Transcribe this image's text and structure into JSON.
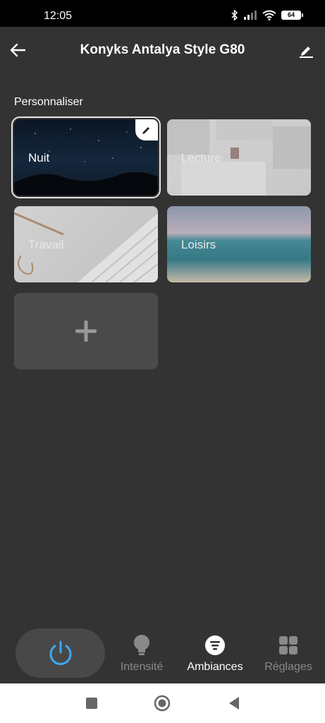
{
  "status_bar": {
    "time": "12:05",
    "battery": "64"
  },
  "app_bar": {
    "title": "Konyks Antalya Style G80"
  },
  "section": {
    "label": "Personnaliser"
  },
  "scenes": [
    {
      "label": "Nuit"
    },
    {
      "label": "Lecture"
    },
    {
      "label": "Travail"
    },
    {
      "label": "Loisirs"
    }
  ],
  "bottom_nav": {
    "intensite": "Intensité",
    "ambiances": "Ambiances",
    "reglages": "Réglages"
  },
  "colors": {
    "accent": "#3fa9f5",
    "background": "#333333",
    "inactive": "#8a8a8a"
  },
  "icons": [
    "back-arrow-icon",
    "pencil-icon",
    "plus-icon",
    "power-icon",
    "bulb-icon",
    "list-icon",
    "grid-icon"
  ]
}
